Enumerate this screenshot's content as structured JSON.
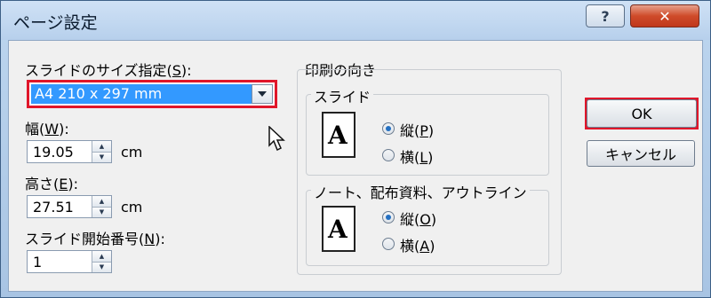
{
  "window": {
    "title": "ページ設定"
  },
  "titlebar": {
    "help_label": "?",
    "close_label": "✕"
  },
  "slide_size": {
    "label": "スライドのサイズ指定(",
    "accel": "S",
    "label_end": "):",
    "selected": "A4 210 x 297 mm"
  },
  "width": {
    "label": "幅(",
    "accel": "W",
    "label_end": "):",
    "value": "19.05",
    "unit": "cm"
  },
  "height": {
    "label": "高さ(",
    "accel": "E",
    "label_end": "):",
    "value": "27.51",
    "unit": "cm"
  },
  "start_number": {
    "label": "スライド開始番号(",
    "accel": "N",
    "label_end": "):",
    "value": "1"
  },
  "orientation": {
    "title": "印刷の向き",
    "slides": {
      "title": "スライド",
      "icon_letter": "A",
      "portrait": {
        "label": "縦(",
        "accel": "P",
        "end": ")",
        "checked": true
      },
      "landscape": {
        "label": "横(",
        "accel": "L",
        "end": ")",
        "checked": false
      }
    },
    "notes": {
      "title": "ノート、配布資料、アウトライン",
      "icon_letter": "A",
      "portrait": {
        "label": "縦(",
        "accel": "O",
        "end": ")",
        "checked": true
      },
      "landscape": {
        "label": "横(",
        "accel": "A",
        "end": ")",
        "checked": false
      }
    }
  },
  "buttons": {
    "ok": "OK",
    "cancel": "キャンセル"
  },
  "highlight_color": "#e0162a"
}
